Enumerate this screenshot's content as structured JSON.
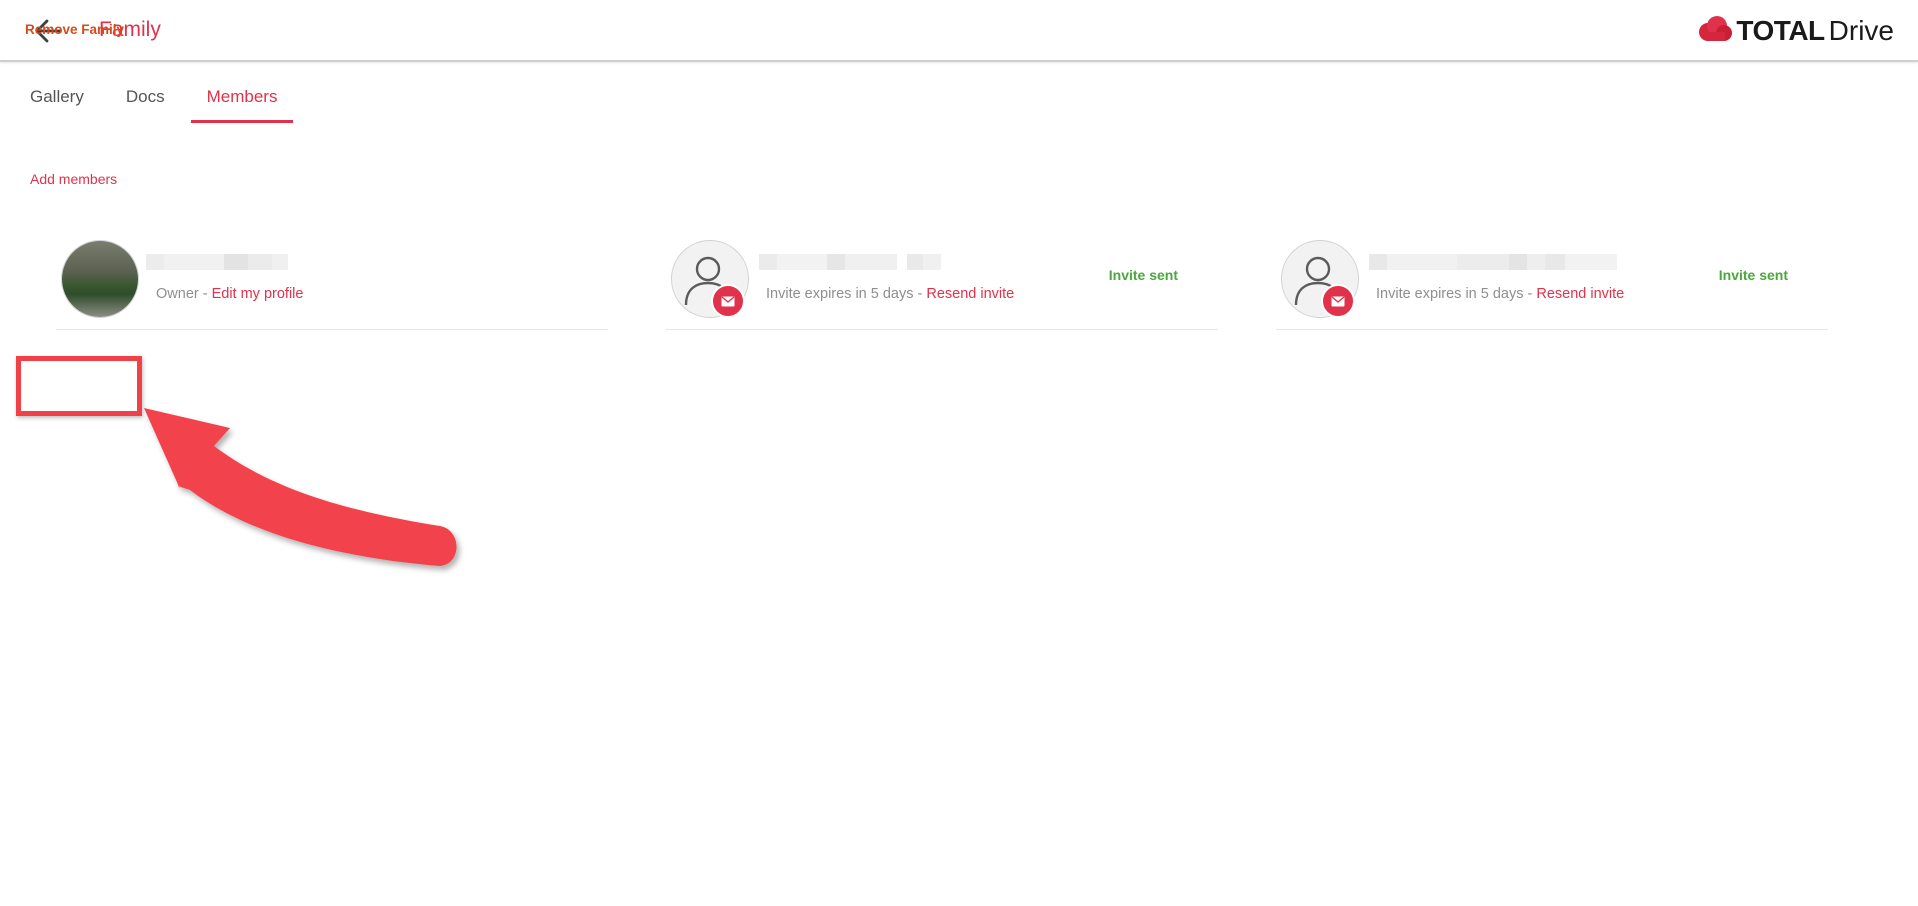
{
  "header": {
    "title": "Family",
    "brand_bold": "TOTAL",
    "brand_regular": "Drive"
  },
  "tabs": [
    {
      "label": "Gallery",
      "active": false
    },
    {
      "label": "Docs",
      "active": false
    },
    {
      "label": "Members",
      "active": true
    }
  ],
  "actions": {
    "add_members": "Add members",
    "remove_family": "Remove Family"
  },
  "members": [
    {
      "role_text": "Owner - ",
      "link_text": "Edit my profile",
      "status": ""
    },
    {
      "role_text": "Invite expires in 5 days - ",
      "link_text": "Resend invite",
      "status": "Invite sent"
    },
    {
      "role_text": "Invite expires in 5 days - ",
      "link_text": "Resend invite",
      "status": "Invite sent"
    }
  ],
  "colors": {
    "accent": "#e0324b",
    "success": "#4aa83d",
    "annotation": "#f04048"
  },
  "icons": [
    "back-arrow-icon",
    "cloud-logo-icon",
    "person-icon",
    "mail-icon"
  ]
}
